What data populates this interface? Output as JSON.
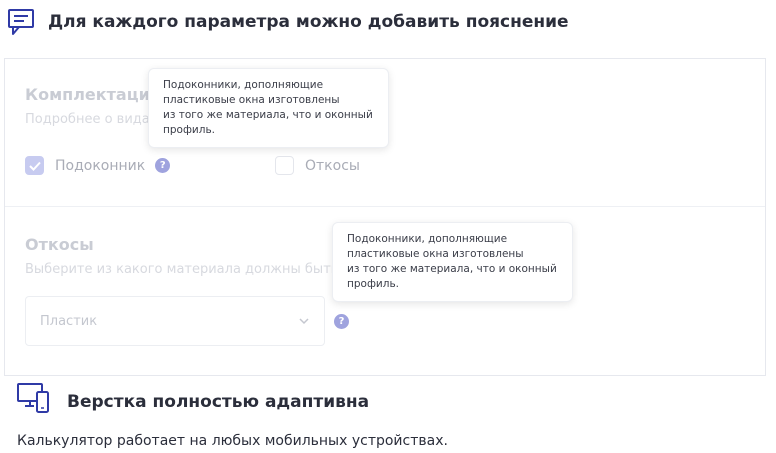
{
  "header": {
    "title": "Для каждого параметра можно добавить пояснение",
    "icon": "comment-icon"
  },
  "section1": {
    "title": "Комплектация",
    "subtitle": "Подробнее о вида",
    "options": [
      {
        "label": "Подоконник",
        "checked": true
      },
      {
        "label": "Откосы",
        "checked": false
      }
    ]
  },
  "section2": {
    "title": "Откосы",
    "subtitle": "Выберите из какого материала должны быть",
    "select_value": "Пластик"
  },
  "tooltip1": {
    "lines": [
      "Подоконники, дополняющие",
      "пластиковые окна изготовлены",
      "из того же материала, что и оконный",
      "профиль."
    ]
  },
  "tooltip2": {
    "lines": [
      "Подоконники, дополняющие",
      "пластиковые окна изготовлены",
      "из того же материала, что и оконный",
      "профиль."
    ]
  },
  "footer": {
    "title": "Верстка полностью адаптивна",
    "text": "Калькулятор работает на любых мобильных устройствах.",
    "icon": "devices-icon"
  },
  "colors": {
    "accent": "#2f3aa6",
    "checked_fill": "#c7cbf0",
    "help_icon": "#9fa3de"
  }
}
